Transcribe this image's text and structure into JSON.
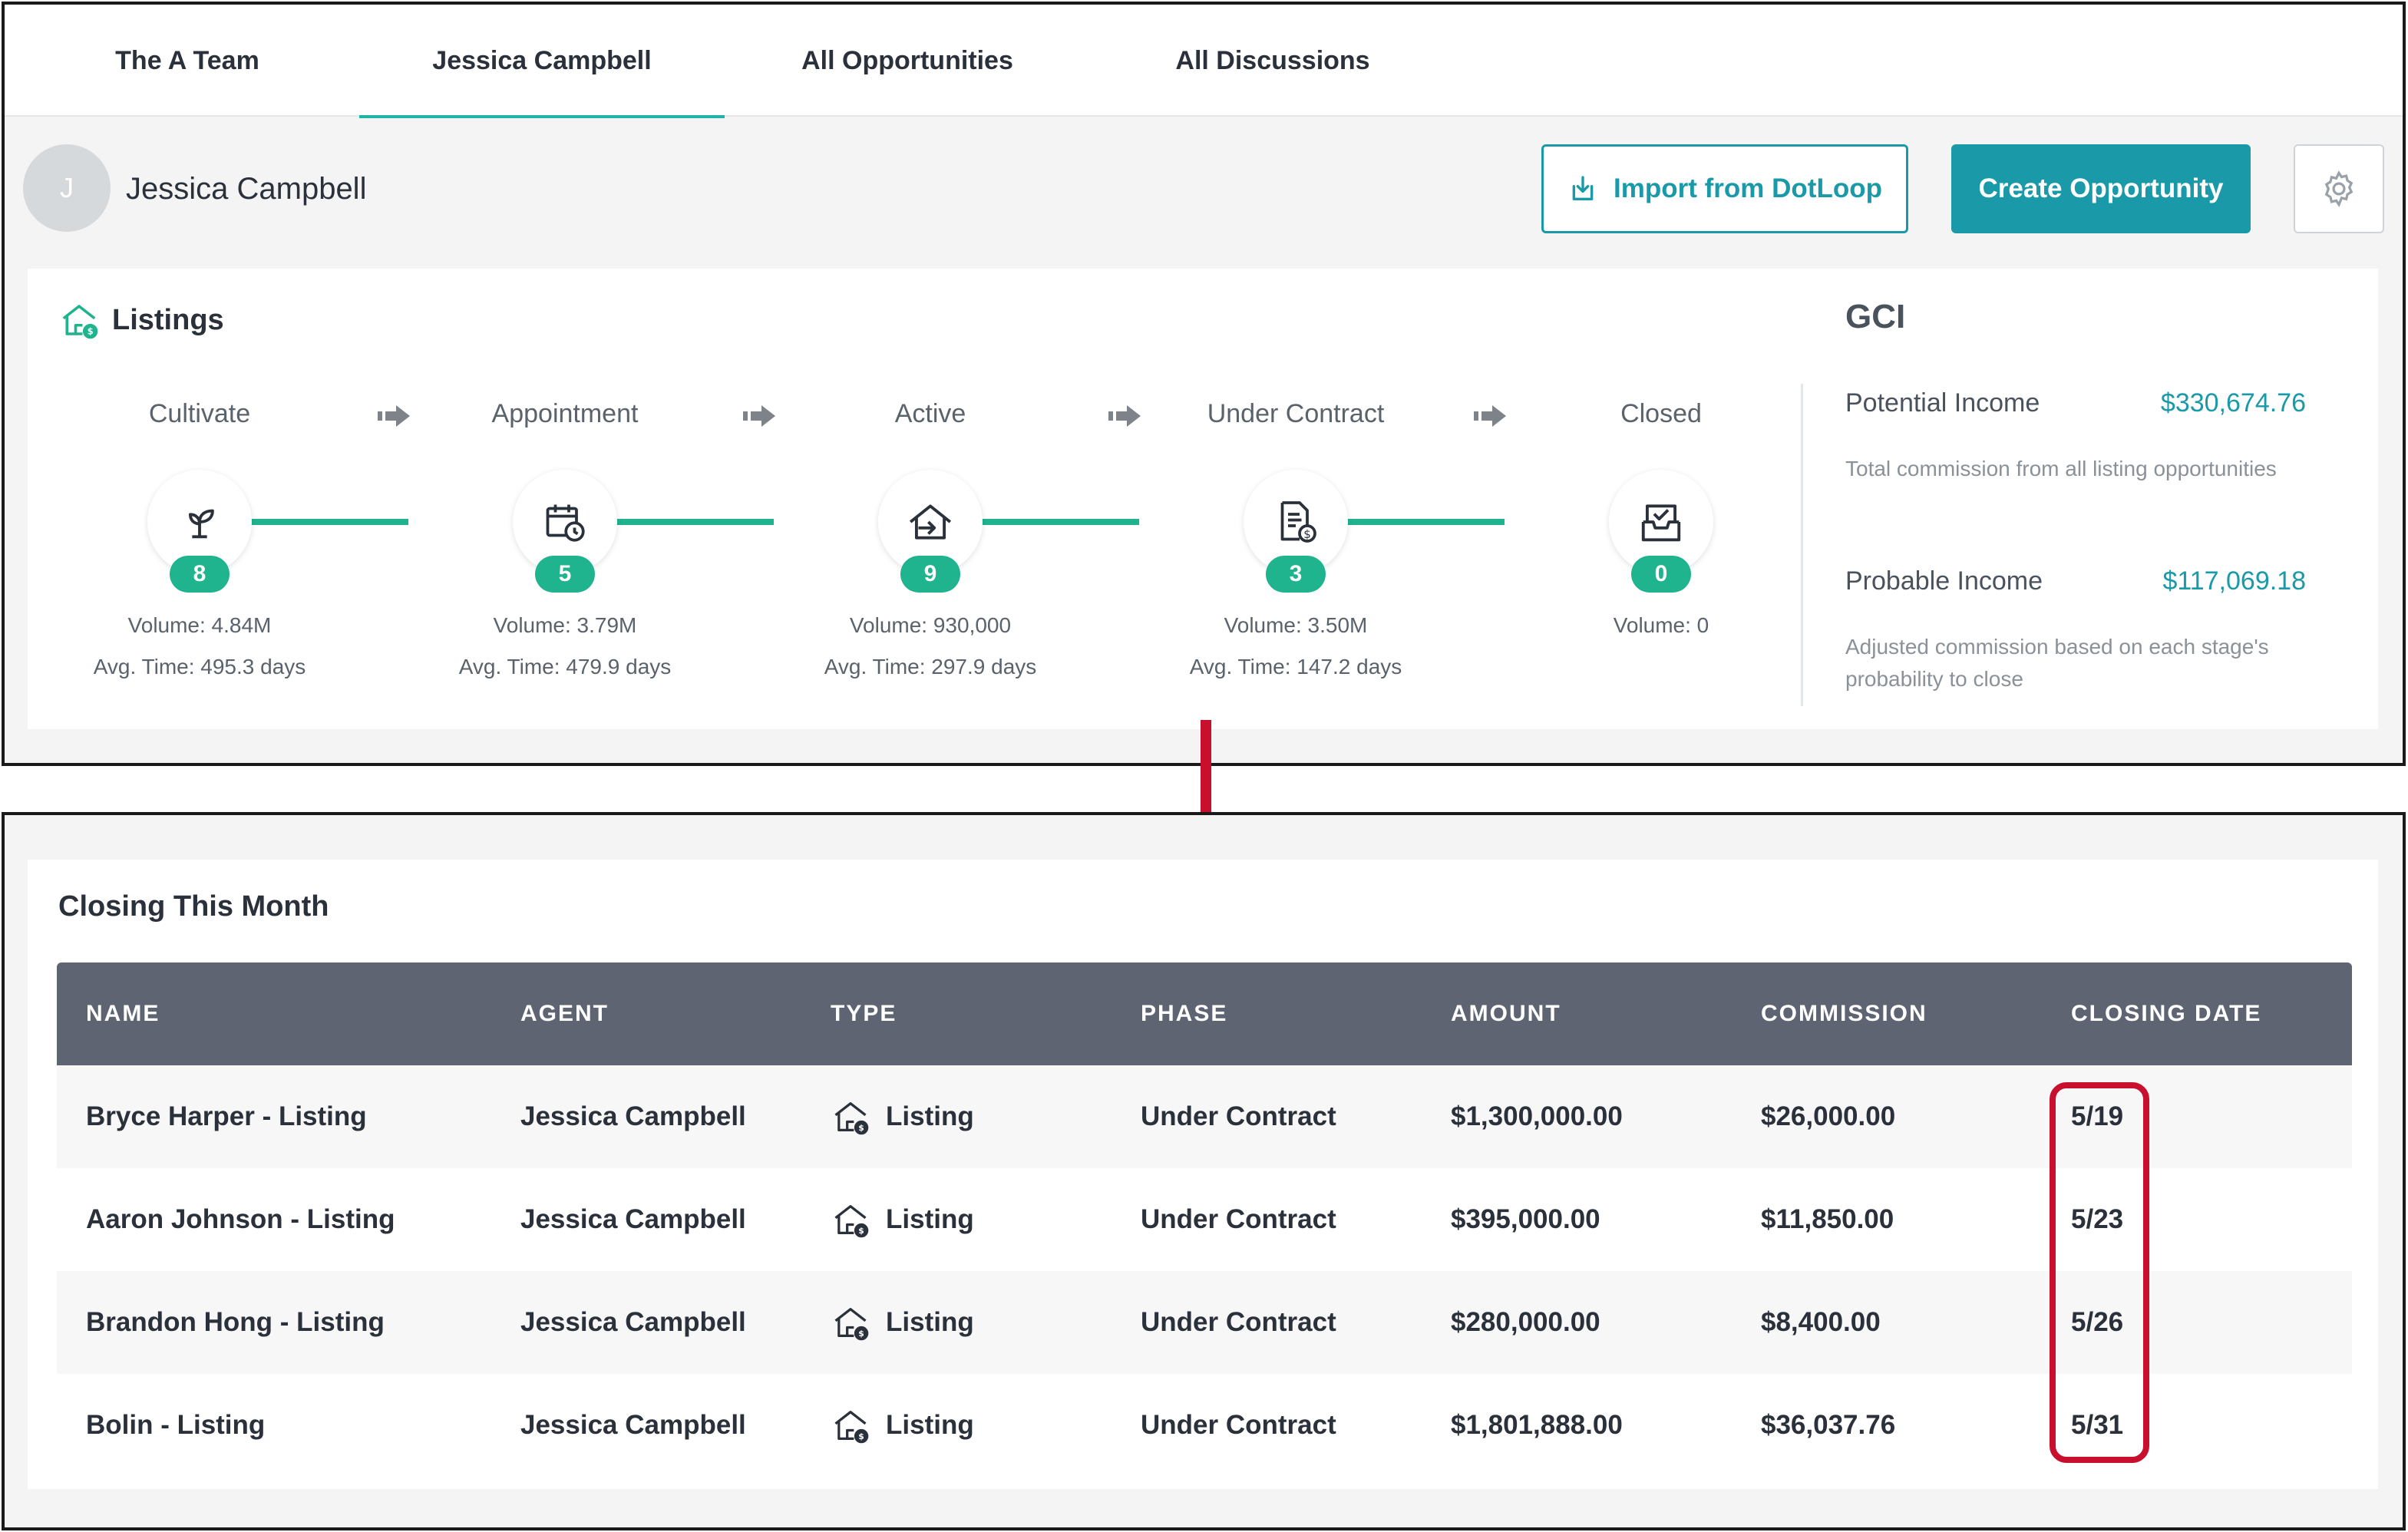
{
  "tabs": [
    {
      "label": "The A Team"
    },
    {
      "label": "Jessica Campbell",
      "active": true
    },
    {
      "label": "All Opportunities"
    },
    {
      "label": "All Discussions"
    }
  ],
  "user": {
    "initial": "J",
    "name": "Jessica Campbell"
  },
  "actions": {
    "import_label": "Import from DotLoop",
    "create_label": "Create Opportunity",
    "settings_icon": "gear-icon"
  },
  "listings": {
    "title": "Listings",
    "icon": "house-dollar-icon",
    "stages": [
      {
        "label": "Cultivate",
        "count": "8",
        "volume": "Volume: 4.84M",
        "avg_time": "Avg. Time: 495.3 days",
        "icon": "sprout-icon"
      },
      {
        "label": "Appointment",
        "count": "5",
        "volume": "Volume: 3.79M",
        "avg_time": "Avg. Time: 479.9 days",
        "icon": "calendar-clock-icon"
      },
      {
        "label": "Active",
        "count": "9",
        "volume": "Volume: 930,000",
        "avg_time": "Avg. Time: 297.9 days",
        "icon": "house-arrow-icon"
      },
      {
        "label": "Under Contract",
        "count": "3",
        "volume": "Volume: 3.50M",
        "avg_time": "Avg. Time: 147.2 days",
        "icon": "contract-dollar-icon"
      },
      {
        "label": "Closed",
        "count": "0",
        "volume": "Volume: 0",
        "avg_time": "",
        "icon": "inbox-check-icon"
      }
    ]
  },
  "gci": {
    "title": "GCI",
    "potential_label": "Potential Income",
    "potential_value": "$330,674.76",
    "potential_desc": "Total commission from all listing opportunities",
    "probable_label": "Probable Income",
    "probable_value": "$117,069.18",
    "probable_desc": "Adjusted commission based on each stage's probability to close"
  },
  "closing": {
    "title": "Closing This Month",
    "columns": [
      "NAME",
      "AGENT",
      "TYPE",
      "PHASE",
      "AMOUNT",
      "COMMISSION",
      "CLOSING DATE"
    ],
    "rows": [
      {
        "name": "Bryce Harper - Listing",
        "agent": "Jessica Campbell",
        "type": "Listing",
        "phase": "Under Contract",
        "amount": "$1,300,000.00",
        "commission": "$26,000.00",
        "closing_date": "5/19"
      },
      {
        "name": "Aaron Johnson - Listing",
        "agent": "Jessica Campbell",
        "type": "Listing",
        "phase": "Under Contract",
        "amount": "$395,000.00",
        "commission": "$11,850.00",
        "closing_date": "5/23"
      },
      {
        "name": "Brandon Hong - Listing",
        "agent": "Jessica Campbell",
        "type": "Listing",
        "phase": "Under Contract",
        "amount": "$280,000.00",
        "commission": "$8,400.00",
        "closing_date": "5/26"
      },
      {
        "name": "Bolin - Listing",
        "agent": "Jessica Campbell",
        "type": "Listing",
        "phase": "Under Contract",
        "amount": "$1,801,888.00",
        "commission": "$36,037.76",
        "closing_date": "5/31"
      }
    ]
  },
  "colors": {
    "accent": "#1a9aa9",
    "progress": "#1fb38e",
    "header": "#5f6473",
    "highlight": "#c8102e"
  }
}
